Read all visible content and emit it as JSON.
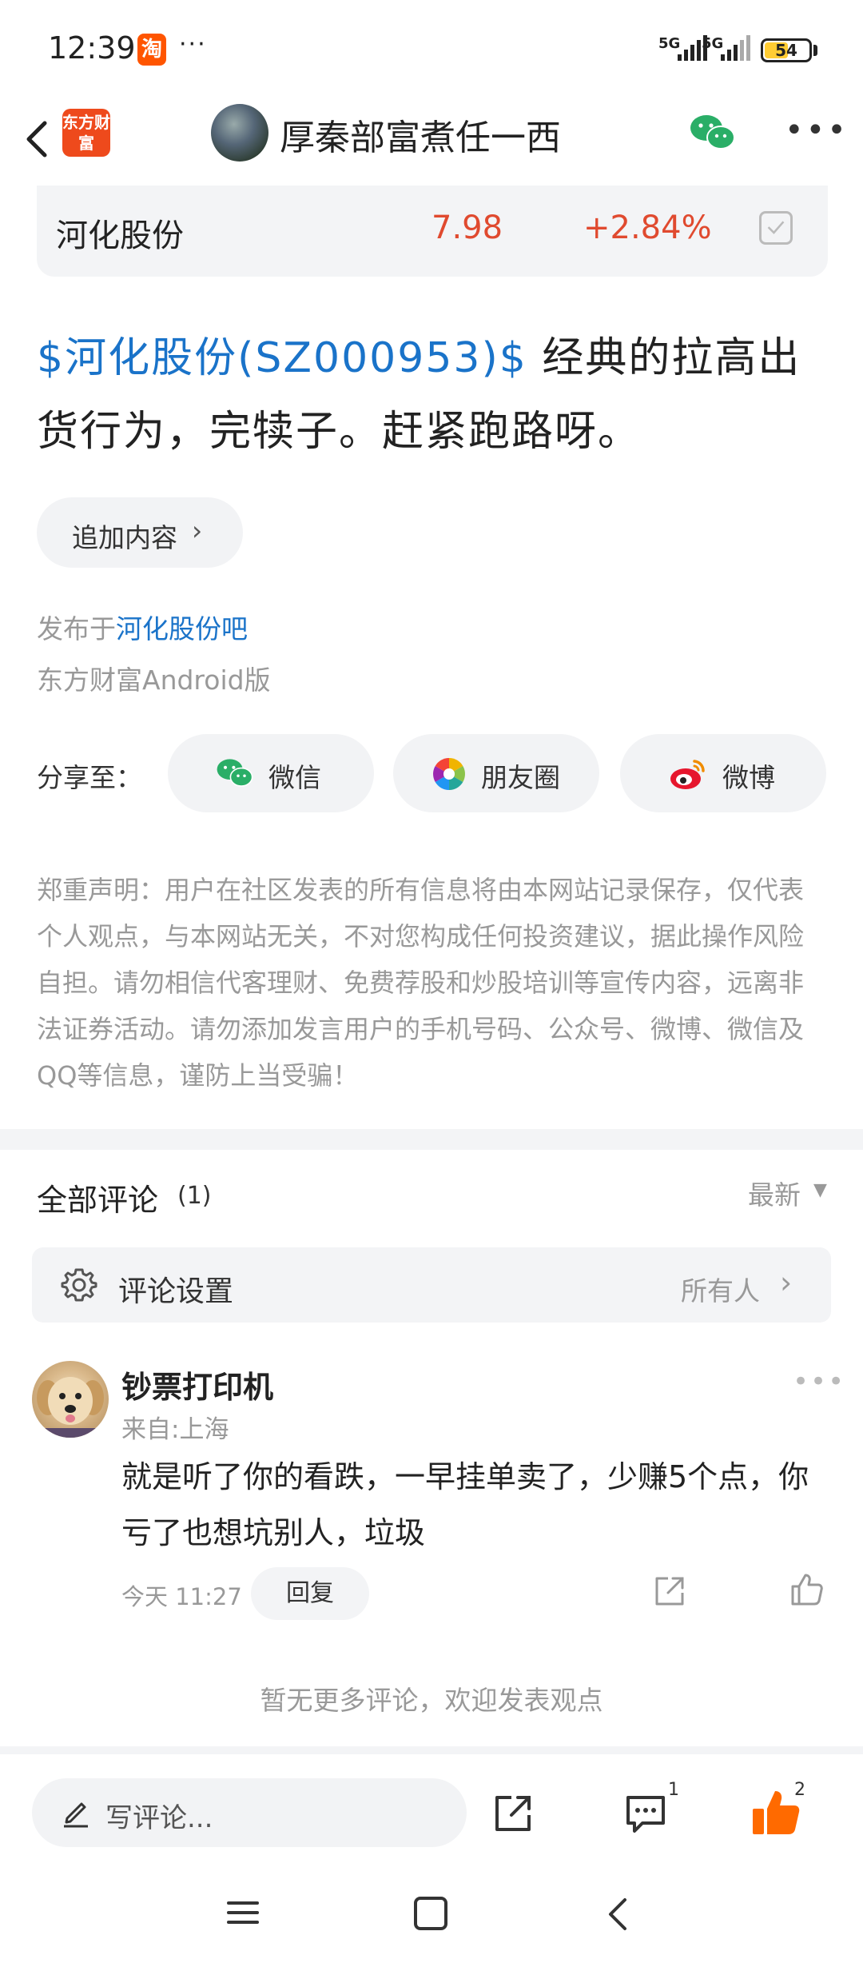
{
  "status_bar": {
    "time": "12:39",
    "taobao_badge": "淘",
    "more_dots": "···",
    "network_1": "5G",
    "network_2": "5G",
    "battery": "54",
    "battery_level_percent": 54
  },
  "header": {
    "app_logo_text": "东方财富",
    "title": "厚秦部富煮任一西",
    "icons": [
      "back-arrow-icon",
      "wechat-icon",
      "more-icon"
    ]
  },
  "stock_card": {
    "name": "河化股份",
    "price": "7.98",
    "change": "+2.84%",
    "accent_color": "#e04a2f"
  },
  "post": {
    "stock_link": "$河化股份(SZ000953)$",
    "text": " 经典的拉高出货行为，完犊子。赶紧跑路呀。",
    "add_content_label": "追加内容",
    "published_prefix": "发布于",
    "published_link": "河化股份吧",
    "client": "东方财富Android版"
  },
  "share": {
    "label": "分享至：",
    "options": [
      {
        "label": "微信",
        "icon": "wechat-icon"
      },
      {
        "label": "朋友圈",
        "icon": "moments-icon"
      },
      {
        "label": "微博",
        "icon": "weibo-icon"
      }
    ]
  },
  "disclaimer": "郑重声明：用户在社区发表的所有信息将由本网站记录保存，仅代表个人观点，与本网站无关，不对您构成任何投资建议，据此操作风险自担。请勿相信代客理财、免费荐股和炒股培训等宣传内容，远离非法证券活动。请勿添加发言用户的手机号码、公众号、微博、微信及QQ等信息，谨防上当受骗！",
  "comments": {
    "title": "全部评论",
    "count": "(1)",
    "sort_label": "最新",
    "settings_label": "评论设置",
    "settings_value": "所有人",
    "items": [
      {
        "user": "钞票打印机",
        "location": "来自:上海",
        "text": "就是听了你的看跌，一早挂单卖了，少赚5个点，你亏了也想坑别人，垃圾",
        "time": "今天 11:27",
        "reply_label": "回复"
      }
    ],
    "no_more": "暂无更多评论，欢迎发表观点"
  },
  "bottom_bar": {
    "write_placeholder": "写评论...",
    "comment_count": "1",
    "like_count": "2",
    "like_color": "#ff6a00"
  }
}
